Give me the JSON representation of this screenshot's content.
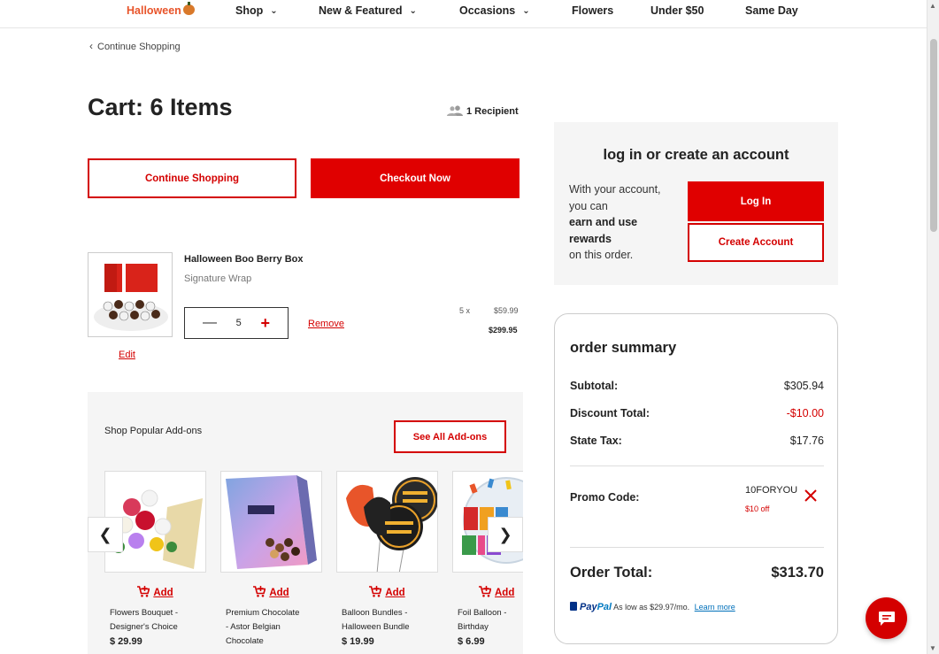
{
  "nav": {
    "items": [
      {
        "label": "Halloween"
      },
      {
        "label": "Shop"
      },
      {
        "label": "New & Featured"
      },
      {
        "label": "Occasions"
      },
      {
        "label": "Flowers"
      },
      {
        "label": "Under $50"
      },
      {
        "label": "Same Day"
      }
    ]
  },
  "back_link": "Continue Shopping",
  "cart": {
    "title": "Cart: 6 Items",
    "recipients": "1 Recipient",
    "continue_label": "Continue Shopping",
    "checkout_label": "Checkout Now"
  },
  "item": {
    "name": "Halloween Boo Berry Box",
    "wrap": "Signature Wrap",
    "qty": "5",
    "remove_label": "Remove",
    "edit_label": "Edit",
    "multiplier": "5 x",
    "unit_price": "$59.99",
    "line_total": "$299.95"
  },
  "addons": {
    "title": "Shop Popular Add-ons",
    "see_all_label": "See All Add-ons",
    "add_label": "Add",
    "cards": [
      {
        "name_line1": "Flowers Bouquet -",
        "name_line2": "Designer's Choice",
        "name_line3": "",
        "price": "$ 29.99"
      },
      {
        "name_line1": "Premium Chocolate",
        "name_line2": "- Astor Belgian",
        "name_line3": "Chocolate",
        "price": ""
      },
      {
        "name_line1": "Balloon Bundles -",
        "name_line2": "Halloween Bundle",
        "name_line3": "",
        "price": "$ 19.99"
      },
      {
        "name_line1": "Foil Balloon -",
        "name_line2": "Birthday",
        "name_line3": "",
        "price": "$ 6.99"
      }
    ]
  },
  "account": {
    "title": "log in or create an account",
    "text_1": "With your account, you can",
    "text_bold": "earn and use rewards",
    "text_2": "on this order.",
    "login_label": "Log In",
    "create_label": "Create Account"
  },
  "summary": {
    "title": "order summary",
    "subtotal_label": "Subtotal:",
    "subtotal": "$305.94",
    "discount_label": "Discount Total:",
    "discount": "-$10.00",
    "tax_label": "State Tax:",
    "tax": "$17.76",
    "promo_label": "Promo Code:",
    "promo_code": "10FORYOU",
    "promo_off": "$10 off",
    "total_label": "Order Total:",
    "total": "$313.70",
    "paypal_brand_1": "Pay",
    "paypal_brand_2": "Pal",
    "paypal_text": "As low as $29.97/mo.",
    "paypal_link": "Learn more"
  },
  "colors": {
    "accent": "#e00000",
    "halloween": "#e8542a",
    "panel_bg": "#f5f5f5"
  }
}
